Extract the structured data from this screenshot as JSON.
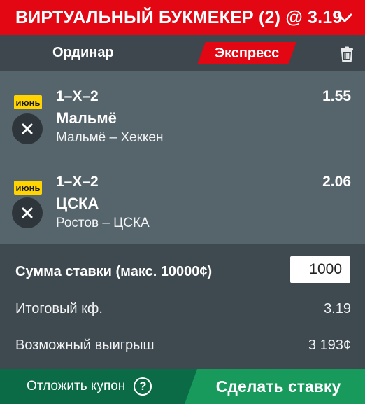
{
  "header": {
    "title": "ВИРТУАЛЬНЫЙ БУКМЕКЕР (2) @ 3.19",
    "collapse_icon": "chevron-down-icon"
  },
  "tabs": {
    "single": "Ординар",
    "express": "Экспресс",
    "active": "express",
    "trash_icon": "trash-icon"
  },
  "bets": [
    {
      "badge": "июнь",
      "market": "1–Х–2",
      "odds": "1.55",
      "selection": "Мальмё",
      "event": "Мальмё – Хеккен"
    },
    {
      "badge": "июнь",
      "market": "1–Х–2",
      "odds": "2.06",
      "selection": "ЦСКА",
      "event": "Ростов – ЦСКА"
    }
  ],
  "summary": {
    "stake_label": "Сумма ставки (макс. 10000¢)",
    "stake_value": "1000",
    "total_odds_label": "Итоговый кф.",
    "total_odds_value": "3.19",
    "possible_win_label": "Возможный выигрыш",
    "possible_win_value": "3 193¢"
  },
  "footer": {
    "postpone_label": "Отложить купон",
    "help_symbol": "?",
    "place_bet_label": "Сделать ставку"
  },
  "colors": {
    "brand_red": "#e30613",
    "badge_yellow": "#ffd400",
    "footer_green": "#0b6b46",
    "action_green": "#179a5c"
  }
}
